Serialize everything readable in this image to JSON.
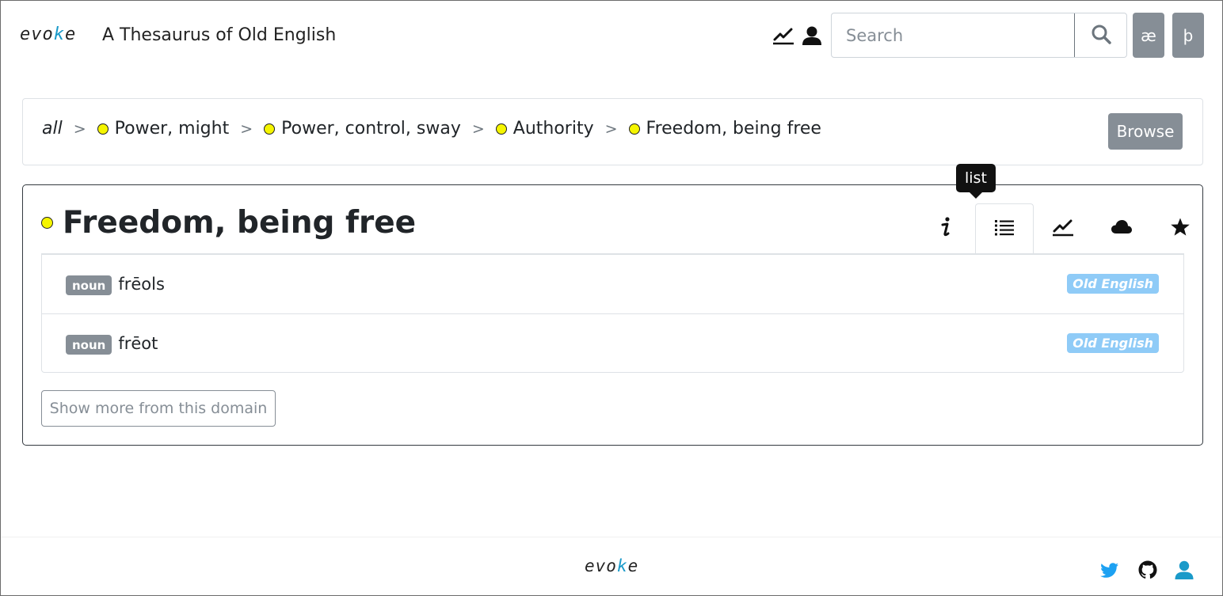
{
  "header": {
    "logo": {
      "before": "evo",
      "accent": "k",
      "after": "e"
    },
    "title": "A Thesaurus of Old English",
    "icons": [
      "chart-icon",
      "user-icon"
    ],
    "search": {
      "placeholder": "Search",
      "value": ""
    },
    "char_buttons": [
      "æ",
      "þ"
    ]
  },
  "breadcrumb": {
    "root": "all",
    "separator": ">",
    "items": [
      "Power, might",
      "Power, control, sway",
      "Authority",
      "Freedom, being free"
    ],
    "browse_label": "Browse"
  },
  "domain": {
    "title": "Freedom, being free",
    "tooltip": "list",
    "tabs": [
      "info",
      "list",
      "chart",
      "cloud",
      "star"
    ],
    "active_tab": "list",
    "words": [
      {
        "pos": "noun",
        "word": "frēols",
        "lang": "Old English"
      },
      {
        "pos": "noun",
        "word": "frēot",
        "lang": "Old English"
      }
    ],
    "show_more_label": "Show more from this domain"
  },
  "footer": {
    "logo": {
      "before": "evo",
      "accent": "k",
      "after": "e"
    },
    "icons": [
      "twitter-icon",
      "github-icon",
      "user-icon"
    ]
  },
  "colors": {
    "dot": "#f5f500",
    "badge_gray": "#868e96",
    "lang_badge": "#8fcbf7",
    "logo_accent": "#1a9ac9",
    "twitter": "#1da1f2",
    "user_footer": "#1a9ac9"
  }
}
